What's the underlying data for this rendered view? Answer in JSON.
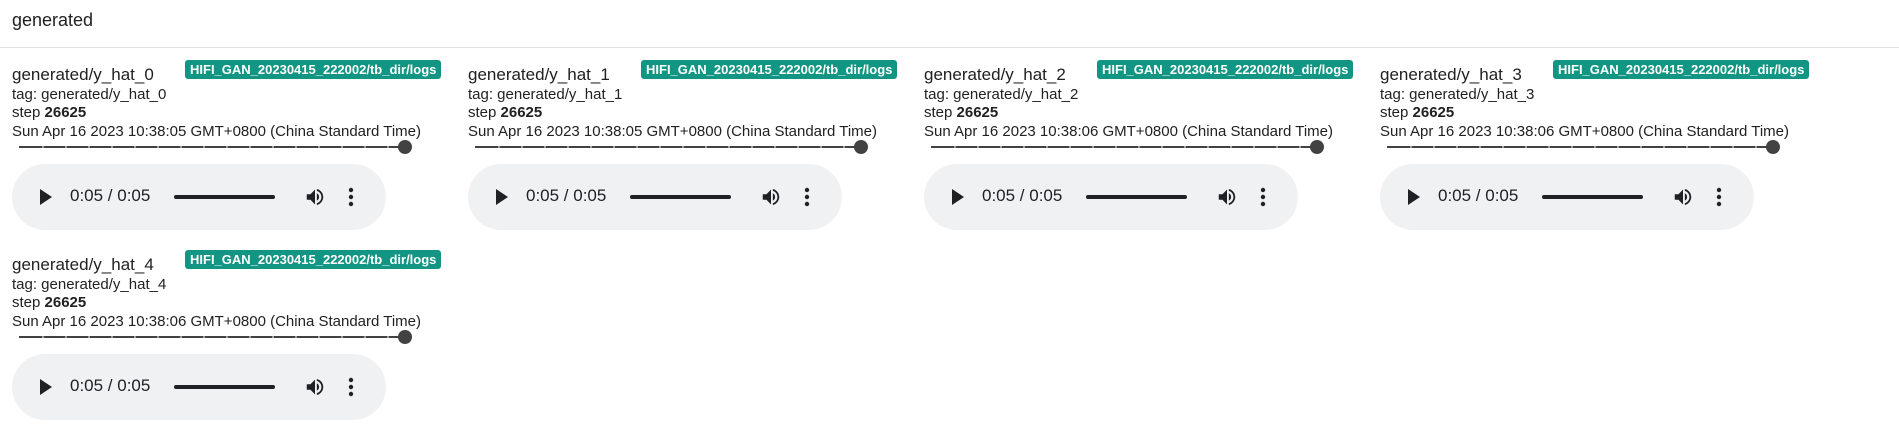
{
  "section": {
    "title": "generated"
  },
  "cards": [
    {
      "title": "generated/y_hat_0",
      "run": "HIFI_GAN_20230415_222002/tb_dir/logs",
      "tag": "tag: generated/y_hat_0",
      "step_label": "step",
      "step": "26625",
      "time": "Sun Apr 16 2023 10:38:05 GMT+0800 (China Standard Time)",
      "audio_time": "0:05 / 0:05"
    },
    {
      "title": "generated/y_hat_1",
      "run": "HIFI_GAN_20230415_222002/tb_dir/logs",
      "tag": "tag: generated/y_hat_1",
      "step_label": "step",
      "step": "26625",
      "time": "Sun Apr 16 2023 10:38:05 GMT+0800 (China Standard Time)",
      "audio_time": "0:05 / 0:05"
    },
    {
      "title": "generated/y_hat_2",
      "run": "HIFI_GAN_20230415_222002/tb_dir/logs",
      "tag": "tag: generated/y_hat_2",
      "step_label": "step",
      "step": "26625",
      "time": "Sun Apr 16 2023 10:38:06 GMT+0800 (China Standard Time)",
      "audio_time": "0:05 / 0:05"
    },
    {
      "title": "generated/y_hat_3",
      "run": "HIFI_GAN_20230415_222002/tb_dir/logs",
      "tag": "tag: generated/y_hat_3",
      "step_label": "step",
      "step": "26625",
      "time": "Sun Apr 16 2023 10:38:06 GMT+0800 (China Standard Time)",
      "audio_time": "0:05 / 0:05"
    },
    {
      "title": "generated/y_hat_4",
      "run": "HIFI_GAN_20230415_222002/tb_dir/logs",
      "tag": "tag: generated/y_hat_4",
      "step_label": "step",
      "step": "26625",
      "time": "Sun Apr 16 2023 10:38:06 GMT+0800 (China Standard Time)",
      "audio_time": "0:05 / 0:05"
    }
  ],
  "colors": {
    "run_badge": "#129582",
    "audio_bg": "#f0f1f3"
  },
  "icons": {
    "play": "play-icon",
    "volume": "volume-icon",
    "more": "more-vert-icon"
  }
}
